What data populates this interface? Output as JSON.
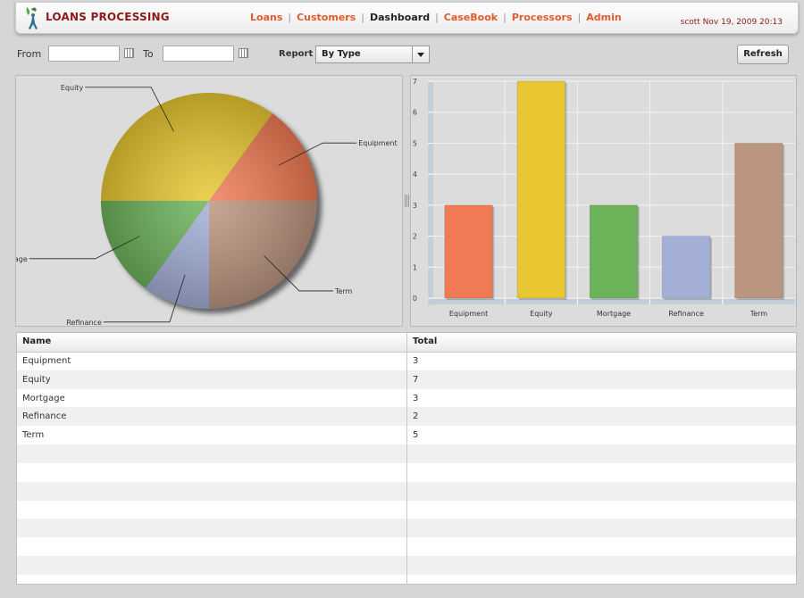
{
  "app": {
    "title": "LOANS PROCESSING",
    "user_info": "scott Nov 19, 2009 20:13",
    "logo_icon": "leaf-person-logo-icon"
  },
  "nav": {
    "items": [
      {
        "label": "Loans",
        "current": false
      },
      {
        "label": "Customers",
        "current": false
      },
      {
        "label": "Dashboard",
        "current": true
      },
      {
        "label": "CaseBook",
        "current": false
      },
      {
        "label": "Processors",
        "current": false
      },
      {
        "label": "Admin",
        "current": false
      }
    ]
  },
  "toolbar": {
    "from_label": "From",
    "from_value": "",
    "to_label": "To",
    "to_value": "",
    "report_label": "Report",
    "report_value": "By Type",
    "refresh_label": "Refresh"
  },
  "colors": {
    "Equipment": "#ef7a54",
    "Equity": "#e8c732",
    "Mortgage": "#6cb35a",
    "Refinance": "#a3afd6",
    "Term": "#bb9580"
  },
  "chart_data": [
    {
      "type": "pie",
      "categories": [
        "Equipment",
        "Equity",
        "Mortgage",
        "Refinance",
        "Term"
      ],
      "values": [
        3,
        7,
        3,
        2,
        5
      ]
    },
    {
      "type": "bar",
      "categories": [
        "Equipment",
        "Equity",
        "Mortgage",
        "Refinance",
        "Term"
      ],
      "values": [
        3,
        7,
        3,
        2,
        5
      ],
      "ylim": [
        0,
        7
      ],
      "yticks": [
        "0",
        "1",
        "2",
        "3",
        "4",
        "5",
        "6",
        "7"
      ],
      "grid": true
    }
  ],
  "grid": {
    "columns": [
      "Name",
      "Total"
    ],
    "rows": [
      {
        "name": "Equipment",
        "total": "3"
      },
      {
        "name": "Equity",
        "total": "7"
      },
      {
        "name": "Mortgage",
        "total": "3"
      },
      {
        "name": "Refinance",
        "total": "2"
      },
      {
        "name": "Term",
        "total": "5"
      }
    ]
  }
}
